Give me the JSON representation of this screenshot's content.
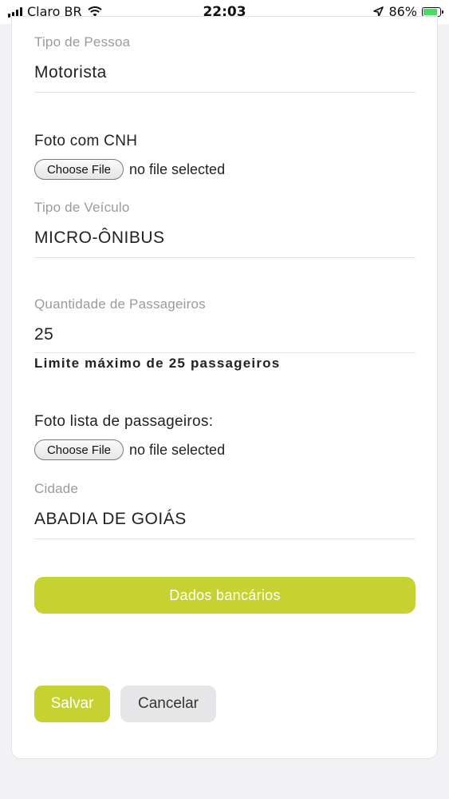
{
  "status_bar": {
    "carrier": "Claro BR",
    "time": "22:03",
    "battery_text": "86%",
    "battery_level": 0.86,
    "battery_color": "#4cd964",
    "icons": [
      "signal-icon",
      "wifi-icon",
      "location-arrow-icon",
      "battery-icon"
    ]
  },
  "form": {
    "tipo_pessoa": {
      "label": "Tipo de Pessoa",
      "value": "Motorista"
    },
    "foto_cnh": {
      "label": "Foto com CNH",
      "button": "Choose File",
      "status": "no file selected"
    },
    "tipo_veiculo": {
      "label": "Tipo de Veículo",
      "value": "MICRO-ÔNIBUS"
    },
    "quantidade": {
      "label": "Quantidade de Passageiros",
      "value": "25",
      "hint": "Limite máximo de 25 passageiros"
    },
    "foto_lista": {
      "label": "Foto lista de passageiros:",
      "button": "Choose File",
      "status": "no file selected"
    },
    "cidade": {
      "label": "Cidade",
      "value": "ABADIA DE GOIÁS"
    }
  },
  "actions": {
    "bank_label": "Dados bancários",
    "save_label": "Salvar",
    "cancel_label": "Cancelar",
    "accent_color": "#c6d232"
  }
}
